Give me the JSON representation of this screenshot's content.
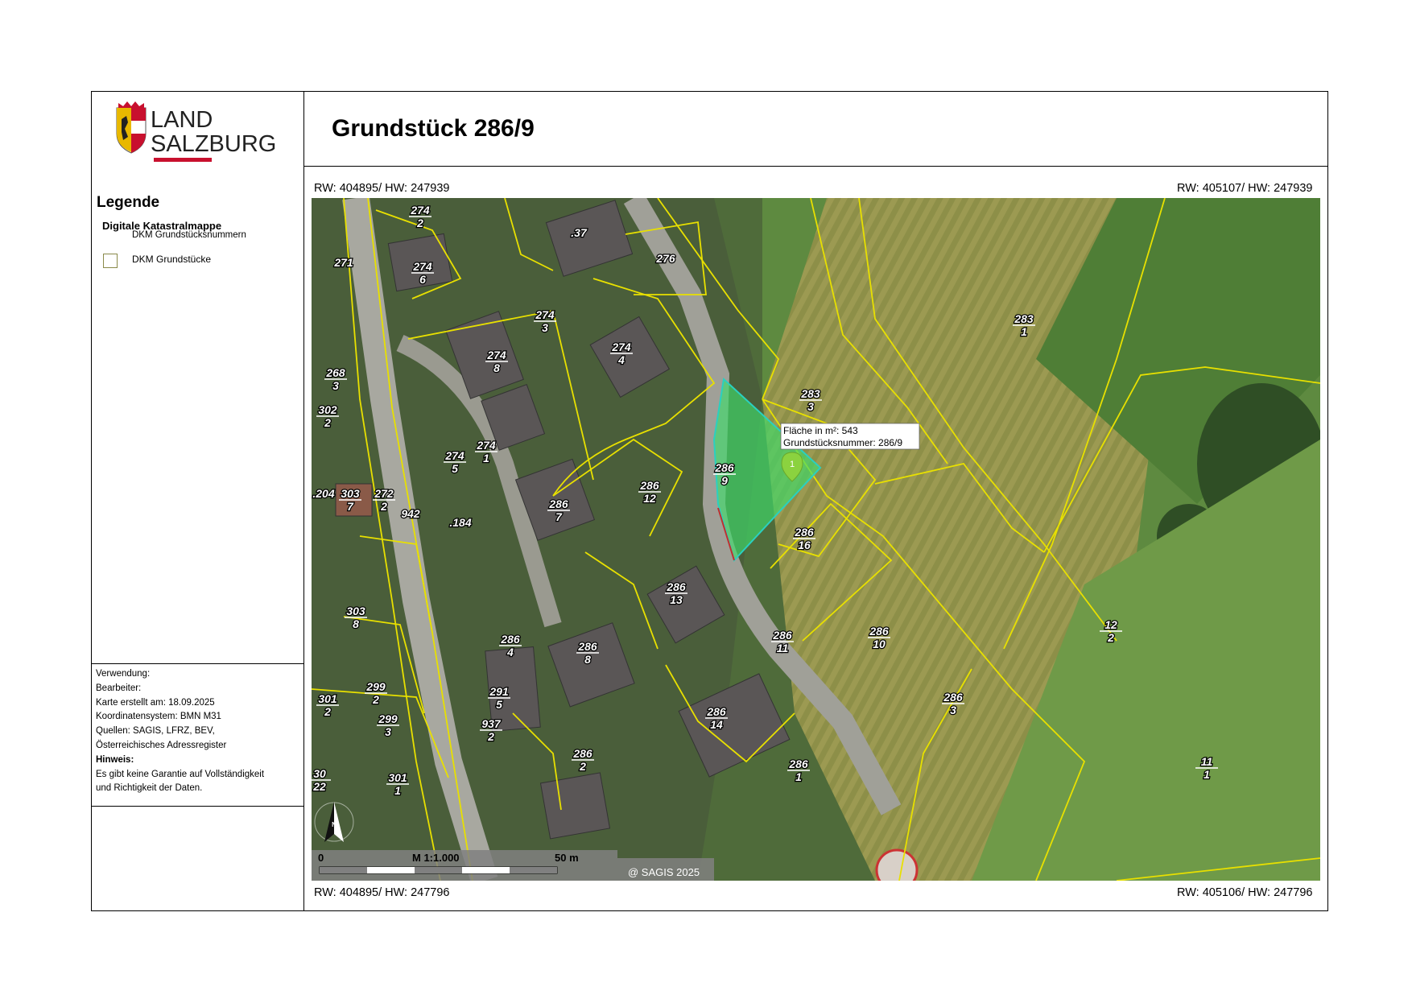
{
  "logo": {
    "line1": "LAND",
    "line2": "SALZBURG",
    "accent": "#c8102e"
  },
  "title": "Grundstück 286/9",
  "legend": {
    "title": "Legende",
    "subtitle": "Digitale Katastralmappe",
    "item1": "DKM Grundstücksnummern",
    "item2": "DKM Grundstücke"
  },
  "info": {
    "usage": "Verwendung:",
    "editor": "Bearbeiter:",
    "created": "Karte erstellt am: 18.09.2025",
    "crs": "Koordinatensystem: BMN M31",
    "sources": "Quellen: SAGIS, LFRZ, BEV,",
    "sources2": "Österreichisches Adressregister",
    "hint_label": "Hinweis:",
    "hint1": "Es gibt keine Garantie auf Vollständigkeit",
    "hint2": "und Richtigkeit der Daten."
  },
  "coords": {
    "top_left": "RW: 404895/ HW: 247939",
    "top_right": "RW: 405107/ HW: 247939",
    "bottom_left": "RW: 404895/ HW: 247796",
    "bottom_right": "RW: 405106/ HW: 247796"
  },
  "map": {
    "popup_area": "Fläche in m²: 543",
    "popup_number": "Grundstücksnummer: 286/9",
    "marker_label": "1",
    "north": "N",
    "scale_zero": "0",
    "scale_text": "M 1:1.000",
    "scale_end": "50 m",
    "copyright": "@ SAGIS 2025",
    "highlight_color": "#3ddc6a",
    "parcel_line_color": "#e8e000",
    "parcels": [
      {
        "n": "274",
        "d": "2"
      },
      {
        "n": ".37",
        "d": ""
      },
      {
        "n": "271",
        "d": ""
      },
      {
        "n": "274",
        "d": "6"
      },
      {
        "n": "276",
        "d": ""
      },
      {
        "n": "274",
        "d": "3"
      },
      {
        "n": "283",
        "d": "1"
      },
      {
        "n": "274",
        "d": "8"
      },
      {
        "n": "274",
        "d": "4"
      },
      {
        "n": "268",
        "d": "3"
      },
      {
        "n": "283",
        "d": "3"
      },
      {
        "n": "302",
        "d": "2"
      },
      {
        "n": "274",
        "d": "5"
      },
      {
        "n": "274",
        "d": "1"
      },
      {
        "n": "286",
        "d": "9"
      },
      {
        "n": "286",
        "d": "12"
      },
      {
        "n": ".204",
        "d": ""
      },
      {
        "n": "303",
        "d": "7"
      },
      {
        "n": "272",
        "d": "2"
      },
      {
        "n": "942",
        "d": ""
      },
      {
        "n": ".184",
        "d": ""
      },
      {
        "n": "286",
        "d": "7"
      },
      {
        "n": "286",
        "d": "16"
      },
      {
        "n": "286",
        "d": "13"
      },
      {
        "n": "303",
        "d": "8"
      },
      {
        "n": "286",
        "d": "11"
      },
      {
        "n": "286",
        "d": "10"
      },
      {
        "n": "12",
        "d": "2"
      },
      {
        "n": "286",
        "d": "4"
      },
      {
        "n": "286",
        "d": "8"
      },
      {
        "n": "299",
        "d": "2"
      },
      {
        "n": "291",
        "d": "5"
      },
      {
        "n": "301",
        "d": "2"
      },
      {
        "n": "286",
        "d": "3"
      },
      {
        "n": "299",
        "d": "3"
      },
      {
        "n": "286",
        "d": "14"
      },
      {
        "n": "937",
        "d": "2"
      },
      {
        "n": "286",
        "d": "2"
      },
      {
        "n": "286",
        "d": "1"
      },
      {
        "n": "30",
        "d": "22"
      },
      {
        "n": "301",
        "d": "1"
      },
      {
        "n": "11",
        "d": "1"
      }
    ]
  }
}
